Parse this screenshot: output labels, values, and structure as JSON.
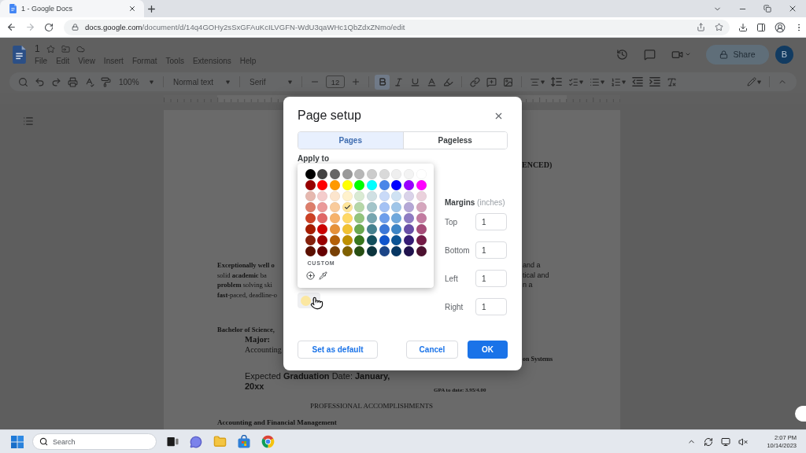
{
  "browser": {
    "tab": {
      "title": "1 - Google Docs"
    },
    "nav": {
      "forward_disabled": true
    },
    "address": {
      "domain": "docs.google.com",
      "path": "/document/d/14q4GOHy2sSxGFAuKcILVGFN-WdU3qaWHc1QbZdxZNmo/edit"
    }
  },
  "docs": {
    "title": "1",
    "menu": [
      "File",
      "Edit",
      "View",
      "Insert",
      "Format",
      "Tools",
      "Extensions",
      "Help"
    ],
    "share_button": "Share",
    "avatar": "B",
    "toolbar": {
      "zoom": "100%",
      "style": "Normal text",
      "font": "Serif",
      "font_size": "12",
      "bold_active": true
    }
  },
  "document": {
    "heading_fragment": "ENCED)",
    "summary": [
      {
        "left": "Exceptionally well o",
        "right": "and a",
        "bold": true
      },
      {
        "left": "solid **academic** ba",
        "right": "tical and",
        "bold": false
      },
      {
        "left": "**problem** solving ski",
        "right": "n a",
        "bold": false
      },
      {
        "left": "**fast**-paced, deadline-o",
        "bold": false
      }
    ],
    "education": {
      "degree": "Bachelor of Science,",
      "major_label": "Major:",
      "major": "Accounting",
      "right_fragment": "on Systems",
      "expected": "Expected **Graduation** Date: **January,**",
      "year": "20xx",
      "gpa": "GPA to date: 3.95/4.00"
    },
    "section_title": "PROFESSIONAL ACCOMPLISHMENTS",
    "subsection": "Accounting and Financial Management"
  },
  "dialog": {
    "title": "Page setup",
    "tabs": [
      {
        "label": "Pages",
        "selected": true
      },
      {
        "label": "Pageless",
        "selected": false
      }
    ],
    "apply_to_label": "Apply to",
    "palette": {
      "rows": [
        [
          {
            "color": "#000000",
            "selected": false
          },
          {
            "color": "#434343",
            "selected": false
          },
          {
            "color": "#666666",
            "selected": false
          },
          {
            "color": "#999999",
            "selected": false
          },
          {
            "color": "#b7b7b7",
            "selected": false
          },
          {
            "color": "#cccccc",
            "selected": false
          },
          {
            "color": "#d9d9d9",
            "selected": false
          },
          {
            "color": "#efefef",
            "selected": false
          },
          {
            "color": "#f3f3f3",
            "selected": false
          },
          {
            "color": "#ffffff",
            "selected": false
          }
        ],
        [
          {
            "color": "#980000",
            "selected": false
          },
          {
            "color": "#ff0000",
            "selected": false
          },
          {
            "color": "#ff9900",
            "selected": false
          },
          {
            "color": "#ffff00",
            "selected": false
          },
          {
            "color": "#00ff00",
            "selected": false
          },
          {
            "color": "#00ffff",
            "selected": false
          },
          {
            "color": "#4a86e8",
            "selected": false
          },
          {
            "color": "#0000ff",
            "selected": false
          },
          {
            "color": "#9900ff",
            "selected": false
          },
          {
            "color": "#ff00ff",
            "selected": false
          }
        ],
        [
          {
            "color": "#e6b8af",
            "selected": false
          },
          {
            "color": "#f4cccc",
            "selected": false
          },
          {
            "color": "#fce5cd",
            "selected": false
          },
          {
            "color": "#fff2cc",
            "selected": false
          },
          {
            "color": "#d9ead3",
            "selected": false
          },
          {
            "color": "#d0e0e3",
            "selected": false
          },
          {
            "color": "#c9daf8",
            "selected": false
          },
          {
            "color": "#cfe2f3",
            "selected": false
          },
          {
            "color": "#d9d2e9",
            "selected": false
          },
          {
            "color": "#ead1dc",
            "selected": false
          }
        ],
        [
          {
            "color": "#dd7e6b",
            "selected": false
          },
          {
            "color": "#ea9999",
            "selected": false
          },
          {
            "color": "#f9cb9c",
            "selected": false
          },
          {
            "color": "#ffe599",
            "selected": true
          },
          {
            "color": "#b6d7a8",
            "selected": false
          },
          {
            "color": "#a2c4c9",
            "selected": false
          },
          {
            "color": "#a4c2f4",
            "selected": false
          },
          {
            "color": "#9fc5e8",
            "selected": false
          },
          {
            "color": "#b4a7d6",
            "selected": false
          },
          {
            "color": "#d5a6bd",
            "selected": false
          }
        ],
        [
          {
            "color": "#cc4125",
            "selected": false
          },
          {
            "color": "#e06666",
            "selected": false
          },
          {
            "color": "#f6b26b",
            "selected": false
          },
          {
            "color": "#ffd966",
            "selected": false
          },
          {
            "color": "#93c47d",
            "selected": false
          },
          {
            "color": "#76a5af",
            "selected": false
          },
          {
            "color": "#6d9eeb",
            "selected": false
          },
          {
            "color": "#6fa8dc",
            "selected": false
          },
          {
            "color": "#8e7cc3",
            "selected": false
          },
          {
            "color": "#c27ba0",
            "selected": false
          }
        ],
        [
          {
            "color": "#a61c00",
            "selected": false
          },
          {
            "color": "#cc0000",
            "selected": false
          },
          {
            "color": "#e69138",
            "selected": false
          },
          {
            "color": "#f1c232",
            "selected": false
          },
          {
            "color": "#6aa84f",
            "selected": false
          },
          {
            "color": "#45818e",
            "selected": false
          },
          {
            "color": "#3c78d8",
            "selected": false
          },
          {
            "color": "#3d85c6",
            "selected": false
          },
          {
            "color": "#674ea7",
            "selected": false
          },
          {
            "color": "#a64d79",
            "selected": false
          }
        ],
        [
          {
            "color": "#85200c",
            "selected": false
          },
          {
            "color": "#990000",
            "selected": false
          },
          {
            "color": "#b45f06",
            "selected": false
          },
          {
            "color": "#bf9000",
            "selected": false
          },
          {
            "color": "#38761d",
            "selected": false
          },
          {
            "color": "#134f5c",
            "selected": false
          },
          {
            "color": "#1155cc",
            "selected": false
          },
          {
            "color": "#0b5394",
            "selected": false
          },
          {
            "color": "#351c75",
            "selected": false
          },
          {
            "color": "#741b47",
            "selected": false
          }
        ],
        [
          {
            "color": "#5b0f00",
            "selected": false
          },
          {
            "color": "#660000",
            "selected": false
          },
          {
            "color": "#783f04",
            "selected": false
          },
          {
            "color": "#7f6000",
            "selected": false
          },
          {
            "color": "#274e13",
            "selected": false
          },
          {
            "color": "#0c343d",
            "selected": false
          },
          {
            "color": "#1c4587",
            "selected": false
          },
          {
            "color": "#073763",
            "selected": false
          },
          {
            "color": "#20124d",
            "selected": false
          },
          {
            "color": "#4c1130",
            "selected": false
          }
        ]
      ],
      "custom_label": "CUSTOM"
    },
    "margins_label": "**Margins** (inches)",
    "margins": [
      {
        "label": "Top",
        "value": "1"
      },
      {
        "label": "Bottom",
        "value": "1"
      },
      {
        "label": "Left",
        "value": "1"
      },
      {
        "label": "Right",
        "value": "1"
      }
    ],
    "buttons": {
      "set_default": "Set as default",
      "cancel": "Cancel",
      "ok": "OK"
    }
  },
  "taskbar": {
    "search": {
      "placeholder": "Search"
    },
    "time": "2:07 PM",
    "date": "10/14/2023"
  }
}
